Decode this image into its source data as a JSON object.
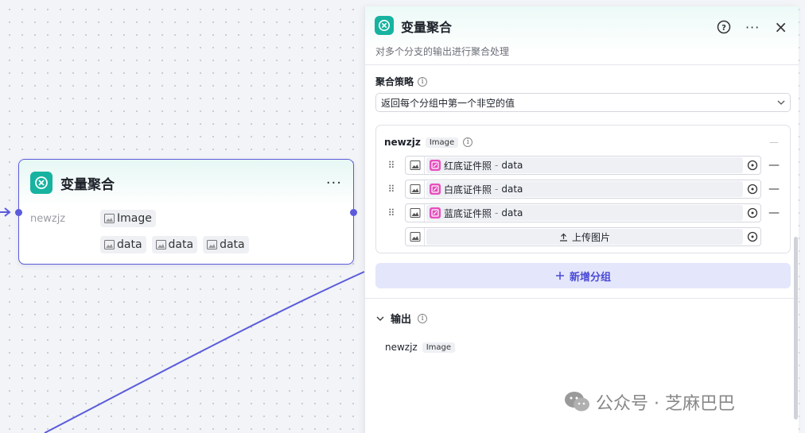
{
  "node": {
    "title": "变量聚合",
    "menu": "···",
    "var_name": "newzjz",
    "type_chip": "Image",
    "data_chips": [
      "data",
      "data",
      "data"
    ]
  },
  "panel": {
    "title": "变量聚合",
    "description": "对多个分支的输出进行聚合处理",
    "tools": {
      "help": "?",
      "more": "···",
      "close": "×"
    },
    "strategy": {
      "label": "聚合策略",
      "selected": "返回每个分组中第一个非空的值"
    },
    "group": {
      "name": "newzjz",
      "type": "Image",
      "items": [
        {
          "source": "红底证件照",
          "sep": "-",
          "field": "data"
        },
        {
          "source": "白底证件照",
          "sep": "-",
          "field": "data"
        },
        {
          "source": "蓝底证件照",
          "sep": "-",
          "field": "data"
        }
      ],
      "upload_label": "上传图片"
    },
    "add_group_label": "新增分组",
    "output": {
      "label": "输出",
      "name": "newzjz",
      "type": "Image"
    }
  },
  "watermark": {
    "text": "公众号 · 芝麻巴巴"
  },
  "colors": {
    "accent": "#5b5bdc",
    "teal": "#17b3a0",
    "pink": "#e64fbd"
  }
}
